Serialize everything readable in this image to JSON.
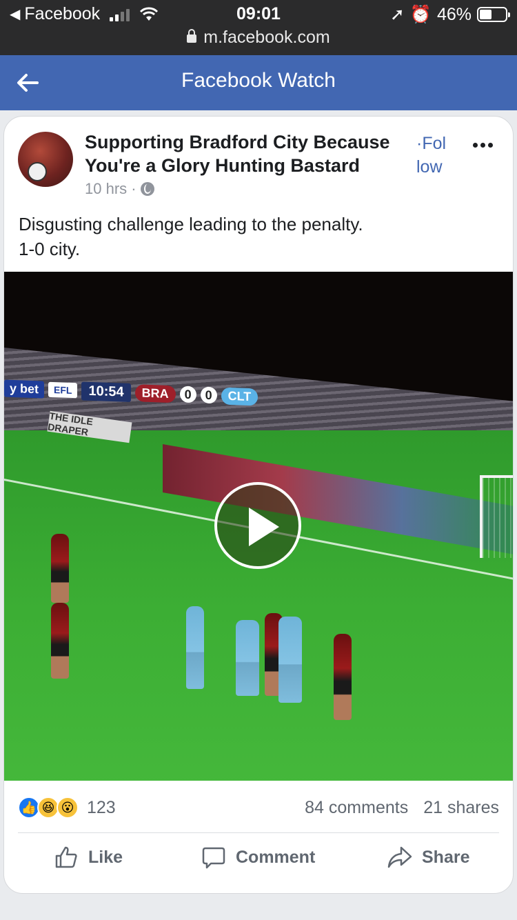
{
  "status_bar": {
    "back_app": "Facebook",
    "time": "09:01",
    "battery": "46%",
    "battery_level": 0.46,
    "url": "m.facebook.com"
  },
  "header": {
    "title": "Facebook Watch",
    "back_icon": "arrow-left-icon"
  },
  "post": {
    "page_name": "Supporting Bradford City Because You're a Glory Hunting Bastard",
    "follow_label": "·Fol\nlow",
    "time_ago": "10 hrs ·",
    "privacy_icon": "globe-icon",
    "text": "Disgusting challenge leading to the penalty.\n1-0 city."
  },
  "video": {
    "scoreboard": {
      "sponsor": "y bet",
      "league": "EFL",
      "clock": "10:54",
      "home": "BRA",
      "home_score": "0",
      "away_score": "0",
      "away": "CLT"
    },
    "board_text": "THE IDLE DRAPER",
    "play_icon": "play-icon"
  },
  "stats": {
    "reaction_count": "123",
    "comments": "84 comments",
    "shares": "21 shares"
  },
  "actions": {
    "like": "Like",
    "comment": "Comment",
    "share": "Share"
  },
  "colors": {
    "header_blue": "#4267b2",
    "status_bar": "#2b2b2c",
    "link_blue": "#4267b2"
  }
}
